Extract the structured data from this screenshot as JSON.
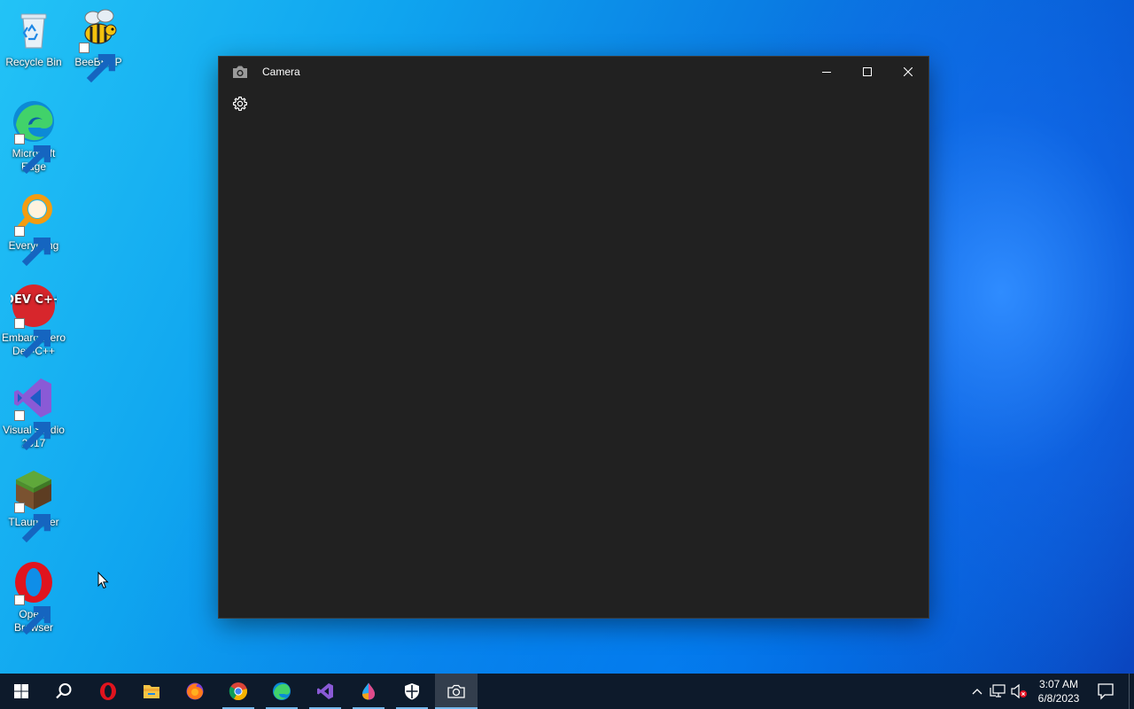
{
  "desktop": {
    "icons": [
      {
        "label": "Recycle Bin",
        "icon": "recycle-bin-icon"
      },
      {
        "label": "BeeBEEP",
        "icon": "bee-icon"
      },
      {
        "label": "Microsoft Edge",
        "icon": "edge-icon"
      },
      {
        "label": "Everything",
        "icon": "magnifier-icon"
      },
      {
        "label": "Embarcadero Dev-C++",
        "icon": "devcpp-icon"
      },
      {
        "label": "Visual Studio 2017",
        "icon": "visual-studio-icon"
      },
      {
        "label": "TLauncher",
        "icon": "grass-block-icon"
      },
      {
        "label": "Opera Browser",
        "icon": "opera-icon"
      }
    ],
    "devcpp_logo_text": "DEV C++"
  },
  "window": {
    "title": "Camera",
    "icon": "camera-icon",
    "controls": [
      "minimize",
      "maximize",
      "close"
    ],
    "settings_icon": "gear-icon"
  },
  "taskbar": {
    "items": [
      "start",
      "search",
      "opera",
      "file-explorer",
      "firefox",
      "chrome",
      "edge",
      "visual-studio",
      "paint-drop",
      "windows-security",
      "camera"
    ],
    "active_item": "camera",
    "tray": {
      "time": "3:07 AM",
      "date": "6/8/2023"
    }
  },
  "colors": {
    "window_bg": "#212121",
    "taskbar_bg": "#0d1a2b",
    "accent": "#76b9ed"
  }
}
